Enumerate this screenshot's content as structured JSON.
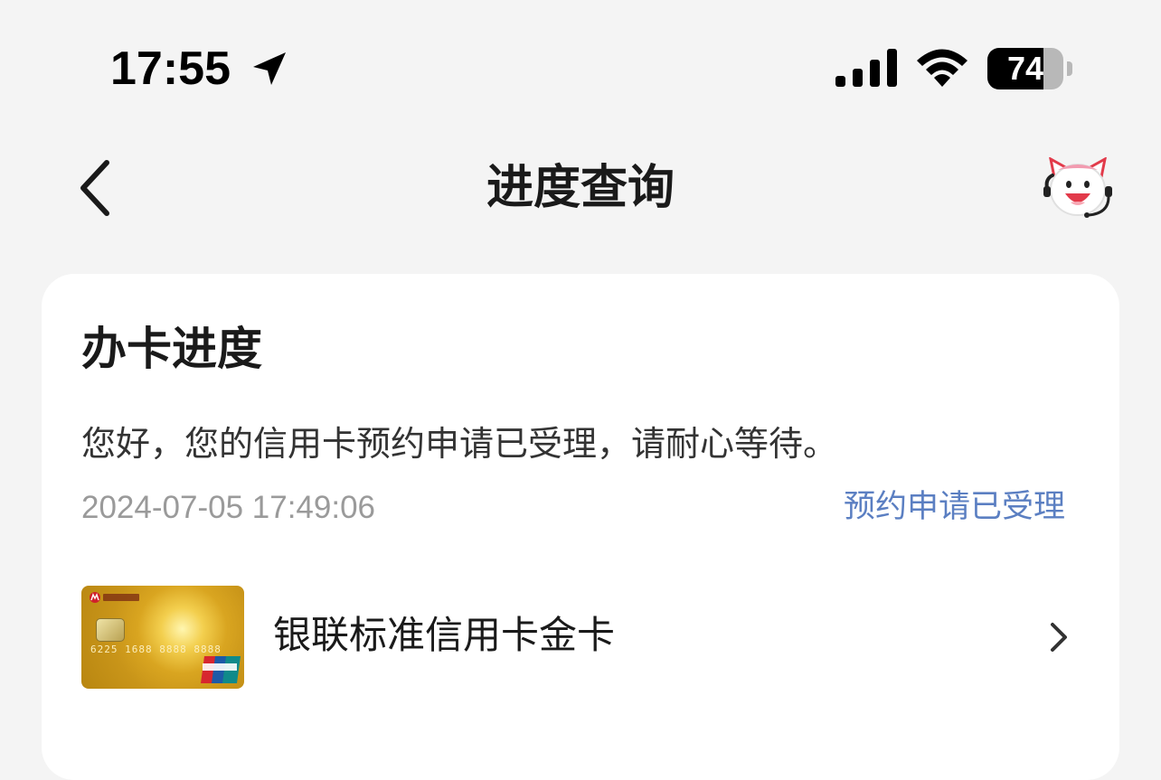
{
  "status_bar": {
    "time": "17:55",
    "battery_level": "74",
    "battery_percent": 74,
    "icons": [
      "location-arrow-icon",
      "cellular-signal-icon",
      "wifi-icon",
      "battery-icon"
    ]
  },
  "nav": {
    "title": "进度查询",
    "back_icon": "chevron-left-icon",
    "assistant_icon": "cat-assistant-icon"
  },
  "card": {
    "title": "办卡进度",
    "message": "您好，您的信用卡预约申请已受理，请耐心等待。",
    "timestamp": "2024-07-05 17:49:06",
    "status": "预约申请已受理",
    "product": {
      "name": "银联标准信用卡金卡",
      "card_number_display": "6225 1688 8888 8888",
      "chevron_icon": "chevron-right-icon"
    }
  },
  "colors": {
    "background": "#f4f4f4",
    "card": "#ffffff",
    "title_text": "#1a1a1a",
    "timestamp_text": "#9a9a9a",
    "status_accent": "#5b7fc2",
    "card_gold": "#d9a520"
  }
}
